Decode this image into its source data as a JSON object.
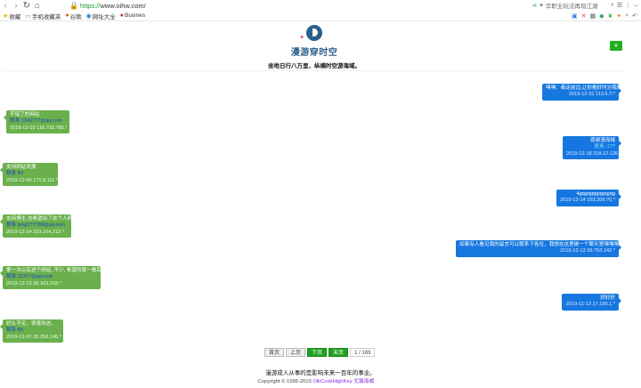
{
  "browser": {
    "url_scheme": "https://",
    "url_host": "www.oihw.com/",
    "search_text": "华职业玩法再现江湖",
    "tools": [
      "⋖",
      "☰",
      "⋮"
    ]
  },
  "bookmarks": [
    {
      "icon": "star-icon",
      "glyph": "★",
      "label": "收藏"
    },
    {
      "icon": "file-icon",
      "glyph": "▭",
      "label": "手机收藏夹"
    },
    {
      "icon": "sohu-icon",
      "glyph": "●",
      "label": "谷歌"
    },
    {
      "icon": "globe-icon",
      "glyph": "◉",
      "label": "网址大全"
    },
    {
      "icon": "shop-icon",
      "glyph": "●",
      "label": "Busines"
    }
  ],
  "header": {
    "site_name": "漫游穿时空",
    "slogan": "坐地日行八万里，纵横时空游海域。",
    "add_label": "+"
  },
  "messages": [
    {
      "side": "right",
      "text": "嘿嘿：都走前边,让你看好时分我确好叫",
      "contact": "",
      "meta": "2019-12-31  113.5.?.*"
    },
    {
      "side": "left",
      "text": "不错了的网站",
      "contact": "联系 1340???@qq.com",
      "meta": "2019-12-19  116.?32.?85.*"
    },
    {
      "side": "right",
      "text": "感谢漫海域",
      "contact": "联系: 1??",
      "meta": "2019-12-18  218.12.126.*"
    },
    {
      "side": "left",
      "text": "支持网站发展",
      "contact": "联系 Bil",
      "meta": "2019-12-05  171.8.111.*"
    },
    {
      "side": "right",
      "text": "4gqgqgqgqgqgqg",
      "contact": "",
      "meta": "2019-12-14  103.209.?0.*"
    },
    {
      "side": "left",
      "text": "支持博主,也希望出了这个人网!",
      "contact": "联系 leng1??789@qq.com",
      "meta": "2019-12-14  223.104.212.*"
    },
    {
      "side": "right",
      "text": "如果有人看见我的留言可以联系下各位，我想在这里做一个聊天室嘿嘿嘿",
      "contact": "",
      "meta": "2019-12-13  39.?53.242.*"
    },
    {
      "side": "left",
      "text": "第一次以后进个网站, 不少, 希望同版一看后",
      "contact": "联系 2237?@qq.com",
      "meta": "2019-12-13  39.163.243.*"
    },
    {
      "side": "right",
      "text": "好好好",
      "contact": "",
      "meta": "2019-11-13  17.190.1.*"
    },
    {
      "side": "left",
      "text": "好久不见，很喜欢这。",
      "contact": "联系 Bil",
      "meta": "2019-12-07  35.250.245.*"
    }
  ],
  "pager": {
    "first": "首页",
    "prev": "上页",
    "next": "下页",
    "last": "末页",
    "info": "1 / 169"
  },
  "footer": {
    "line1": "漫游成人从事的是影响未来一百年的事业。",
    "copyright": "Copyright © 1995-2019 ",
    "link": "OlkCodsHighKey 尤瀛海威"
  }
}
